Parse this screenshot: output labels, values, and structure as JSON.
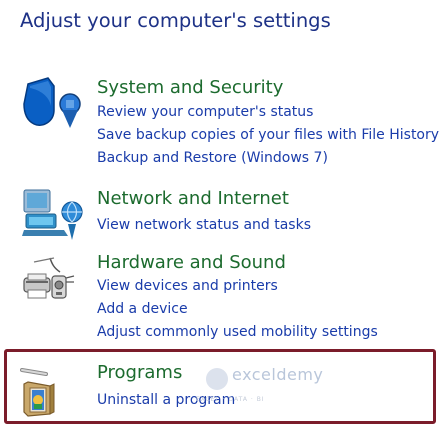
{
  "page": {
    "title": "Adjust your computer's settings"
  },
  "categories": [
    {
      "title": "System and Security",
      "links": [
        "Review your computer's status",
        "Save backup copies of your files with File History",
        "Backup and Restore (Windows 7)"
      ]
    },
    {
      "title": "Network and Internet",
      "links": [
        "View network status and tasks"
      ]
    },
    {
      "title": "Hardware and Sound",
      "links": [
        "View devices and printers",
        "Add a device",
        "Adjust commonly used mobility settings"
      ]
    },
    {
      "title": "Programs",
      "links": [
        "Uninstall a program"
      ]
    }
  ],
  "watermark": {
    "name": "exceldemy",
    "tagline": "EXCEL · DATA · BI"
  },
  "colors": {
    "title": "#1e3287",
    "category_title": "#1c6b2e",
    "link": "#1a3caa",
    "highlight": "#7b1c2a"
  }
}
